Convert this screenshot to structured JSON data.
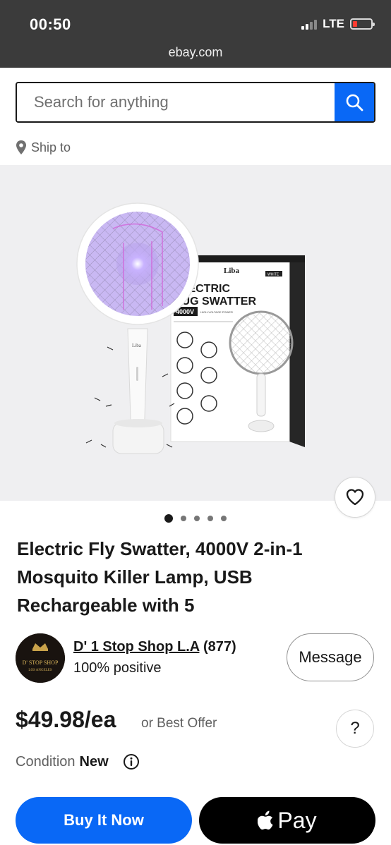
{
  "status_bar": {
    "time": "00:50",
    "network": "LTE"
  },
  "browser": {
    "url": "ebay.com"
  },
  "search": {
    "placeholder": "Search for anything"
  },
  "ship_to": {
    "label": "Ship to"
  },
  "product_image": {
    "brand_on_box": "Liba",
    "box_tag": "WHITE",
    "box_title_line1": "ELECTRIC",
    "box_title_line2": "BUG SWATTER",
    "box_voltage": "4000V",
    "box_voltage_note": "HIGH-VOLTAGE POWER",
    "brand_on_handle": "Liba",
    "image_count": 5,
    "active_index": 0
  },
  "product": {
    "title": "Electric Fly Swatter, 4000V 2-in-1 Mosquito Killer Lamp, USB Rechargeable with 5"
  },
  "seller": {
    "name": "D' 1 Stop Shop L.A",
    "feedback_count": "(877)",
    "positive": "100% positive",
    "avatar_text_line1": "D' STOP SHOP",
    "avatar_text_line2": "LOS ANGELES",
    "message_label": "Message"
  },
  "pricing": {
    "price": "$49.98/ea",
    "best_offer": "or Best Offer",
    "help_label": "?"
  },
  "condition": {
    "label": "Condition",
    "value": "New"
  },
  "actions": {
    "buy_now": "Buy It Now",
    "apple_pay": "Pay"
  },
  "colors": {
    "ebay_blue": "#0968f6",
    "top_bar": "#3b3b3b",
    "battery_low": "#ff3b30"
  }
}
